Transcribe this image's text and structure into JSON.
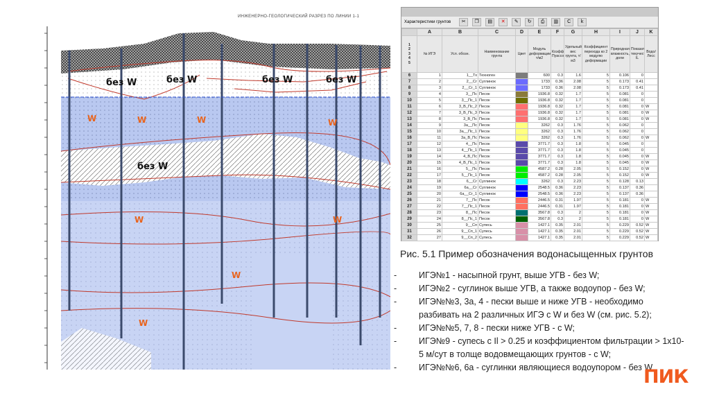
{
  "section": {
    "title": "ИНЖЕНЕРНО-ГЕОЛОГИЧЕСКИЙ РАЗРЕЗ ПО ЛИНИИ 1-1",
    "dry_label": "без W",
    "wet_label": "W"
  },
  "sheet": {
    "toolbar_title": "Характеристики грунтов",
    "columns": [
      "A",
      "B",
      "C",
      "D",
      "E",
      "F",
      "G",
      "H",
      "I",
      "J",
      "K"
    ],
    "headers": [
      "№ ИГЭ",
      "Усл. обозн.",
      "Наименование грунта",
      "Цвет",
      "Модуль деформации, т/м2",
      "Коэффициент Пуассона",
      "Удельный вес грунта, т/м3",
      "Коэффициент перехода ко 2 модулю деформации",
      "Природная влажность, доли",
      "Показатель текучести IL",
      "Водо/ Лесс"
    ],
    "rows": [
      {
        "n": "1",
        "code": "1__Тх",
        "name": "Техноген",
        "color": "#7c7c7c",
        "e": "600",
        "f": "0.3",
        "g": "1.6",
        "h": "5",
        "i": "0.106",
        "j": "0",
        "k": ""
      },
      {
        "n": "2",
        "code": "2__Сг",
        "name": "Суглинок",
        "color": "#6b6bff",
        "e": "1733",
        "f": "0.36",
        "g": "2.08",
        "h": "5",
        "i": "0.173",
        "j": "0.41",
        "k": ""
      },
      {
        "n": "3",
        "code": "2__Сг_1",
        "name": "Суглинок",
        "color": "#6b6bff",
        "e": "1733",
        "f": "0.36",
        "g": "2.08",
        "h": "5",
        "i": "0.173",
        "j": "0.41",
        "k": ""
      },
      {
        "n": "4",
        "code": "3__Пс",
        "name": "Песок",
        "color": "#8a7a3a",
        "e": "1936.8",
        "f": "0.32",
        "g": "1.7",
        "h": "5",
        "i": "0.081",
        "j": "0",
        "k": ""
      },
      {
        "n": "5",
        "code": "3__Пс_1",
        "name": "Песок",
        "color": "#6e6e00",
        "e": "1936.8",
        "f": "0.32",
        "g": "1.7",
        "h": "5",
        "i": "0.081",
        "j": "0",
        "k": ""
      },
      {
        "n": "6",
        "code": "3_В_Пс_2",
        "name": "Песок",
        "color": "#ff7070",
        "e": "1936.8",
        "f": "0.32",
        "g": "1.7",
        "h": "5",
        "i": "0.081",
        "j": "0",
        "k": "W"
      },
      {
        "n": "7",
        "code": "3_В_Пс_3",
        "name": "Песок",
        "color": "#ff7070",
        "e": "1936.8",
        "f": "0.32",
        "g": "1.7",
        "h": "5",
        "i": "0.081",
        "j": "0",
        "k": "W"
      },
      {
        "n": "8",
        "code": "3_В_Пс",
        "name": "Песок",
        "color": "#ff7070",
        "e": "1936.8",
        "f": "0.32",
        "g": "1.7",
        "h": "5",
        "i": "0.081",
        "j": "0",
        "k": "W"
      },
      {
        "n": "9",
        "code": "3а__Пс",
        "name": "Песок",
        "color": "#ffff80",
        "e": "3262",
        "f": "0.3",
        "g": "1.76",
        "h": "5",
        "i": "0.062",
        "j": "0",
        "k": ""
      },
      {
        "n": "10",
        "code": "3а__Пс_1",
        "name": "Песок",
        "color": "#ffff80",
        "e": "3262",
        "f": "0.3",
        "g": "1.76",
        "h": "5",
        "i": "0.062",
        "j": "0",
        "k": ""
      },
      {
        "n": "11",
        "code": "3а_В_Пс",
        "name": "Песок",
        "color": "#ffff80",
        "e": "3262",
        "f": "0.3",
        "g": "1.76",
        "h": "5",
        "i": "0.062",
        "j": "0",
        "k": "W"
      },
      {
        "n": "12",
        "code": "4__Пс",
        "name": "Песок",
        "color": "#5a4aaa",
        "e": "3771.7",
        "f": "0.3",
        "g": "1.8",
        "h": "5",
        "i": "0.045",
        "j": "0",
        "k": ""
      },
      {
        "n": "13",
        "code": "4__Пс_1",
        "name": "Песок",
        "color": "#5a4aaa",
        "e": "3771.7",
        "f": "0.3",
        "g": "1.8",
        "h": "5",
        "i": "0.045",
        "j": "0",
        "k": ""
      },
      {
        "n": "14",
        "code": "4_В_Пс",
        "name": "Песок",
        "color": "#5a4aaa",
        "e": "3771.7",
        "f": "0.3",
        "g": "1.8",
        "h": "5",
        "i": "0.045",
        "j": "0",
        "k": "W"
      },
      {
        "n": "15",
        "code": "4_В_Пс_1",
        "name": "Песок",
        "color": "#5a4aaa",
        "e": "3771.7",
        "f": "0.3",
        "g": "1.8",
        "h": "5",
        "i": "0.045",
        "j": "0",
        "k": "W"
      },
      {
        "n": "16",
        "code": "5__Пс",
        "name": "Песок",
        "color": "#00ee00",
        "e": "4587.2",
        "f": "0.28",
        "g": "2.05",
        "h": "5",
        "i": "0.152",
        "j": "0",
        "k": "W"
      },
      {
        "n": "17",
        "code": "5__Пс_1",
        "name": "Песок",
        "color": "#00ee00",
        "e": "4587.2",
        "f": "0.28",
        "g": "2.05",
        "h": "5",
        "i": "0.152",
        "j": "0",
        "k": "W"
      },
      {
        "n": "18",
        "code": "6__Сг",
        "name": "Суглинок",
        "color": "#00ffff",
        "e": "3262",
        "f": "0.3",
        "g": "2.23",
        "h": "5",
        "i": "0.128",
        "j": "0.13",
        "k": ""
      },
      {
        "n": "19",
        "code": "6а__Сг",
        "name": "Суглинок",
        "color": "#0000ff",
        "e": "2548.5",
        "f": "0.36",
        "g": "2.23",
        "h": "5",
        "i": "0.137",
        "j": "0.36",
        "k": ""
      },
      {
        "n": "20",
        "code": "6а__Сг_1",
        "name": "Суглинок",
        "color": "#0000ff",
        "e": "2548.5",
        "f": "0.36",
        "g": "2.23",
        "h": "5",
        "i": "0.137",
        "j": "0.36",
        "k": ""
      },
      {
        "n": "21",
        "code": "7__Пс",
        "name": "Песок",
        "color": "#ff7060",
        "e": "2446.5",
        "f": "0.31",
        "g": "1.97",
        "h": "5",
        "i": "0.181",
        "j": "0",
        "k": "W"
      },
      {
        "n": "22",
        "code": "7__Пс_1",
        "name": "Песок",
        "color": "#ff7060",
        "e": "2446.5",
        "f": "0.31",
        "g": "1.97",
        "h": "5",
        "i": "0.181",
        "j": "0",
        "k": "W"
      },
      {
        "n": "23",
        "code": "8__Пс",
        "name": "Песок",
        "color": "#007070",
        "e": "3567.8",
        "f": "0.3",
        "g": "2",
        "h": "5",
        "i": "0.181",
        "j": "0",
        "k": "W"
      },
      {
        "n": "24",
        "code": "8__Пс_1",
        "name": "Песок",
        "color": "#006000",
        "e": "3567.8",
        "f": "0.3",
        "g": "2",
        "h": "5",
        "i": "0.181",
        "j": "0",
        "k": "W"
      },
      {
        "n": "25",
        "code": "9__Сп",
        "name": "Супесь",
        "color": "#d890a8",
        "e": "1427.1",
        "f": "0.35",
        "g": "2.01",
        "h": "5",
        "i": "0.229",
        "j": "0.52",
        "k": "W"
      },
      {
        "n": "26",
        "code": "9__Сп_1",
        "name": "Супесь",
        "color": "#d890a8",
        "e": "1427.1",
        "f": "0.35",
        "g": "2.01",
        "h": "5",
        "i": "0.229",
        "j": "0.52",
        "k": "W"
      },
      {
        "n": "27",
        "code": "9__Сп_2",
        "name": "Супесь",
        "color": "#d890a8",
        "e": "1427.1",
        "f": "0.35",
        "g": "2.01",
        "h": "5",
        "i": "0.229",
        "j": "0.52",
        "k": "W"
      }
    ]
  },
  "caption": "Рис. 5.1 Пример обозначения водонасыщенных грунтов",
  "bullets": [
    "ИГЭ№1 - насыпной грунт, выше УГВ - без W;",
    "ИГЭ№2 - суглинок выше УГВ, а также водоупор - без W;",
    "ИГЭ№№3, 3а, 4 - пески выше и ниже УГВ - необходимо разбивать на 2 различных ИГЭ с W и без W (см. рис. 5.2);",
    "ИГЭ№№5, 7, 8 - пески ниже УГВ - с W;",
    "ИГЭ№9 - супесь с  Il > 0.25 и коэффициентом фильтрации > 1x10-5 м/сут в толще водовмещающих грунтов - с W;",
    "ИГЭ№№6, 6а - суглинки являющиеся водоупором - без W"
  ],
  "logo": "ПИК",
  "colors": {
    "accent": "#f05a1e",
    "water": "#b9c8f0",
    "water_deep": "#c8d4f4"
  }
}
